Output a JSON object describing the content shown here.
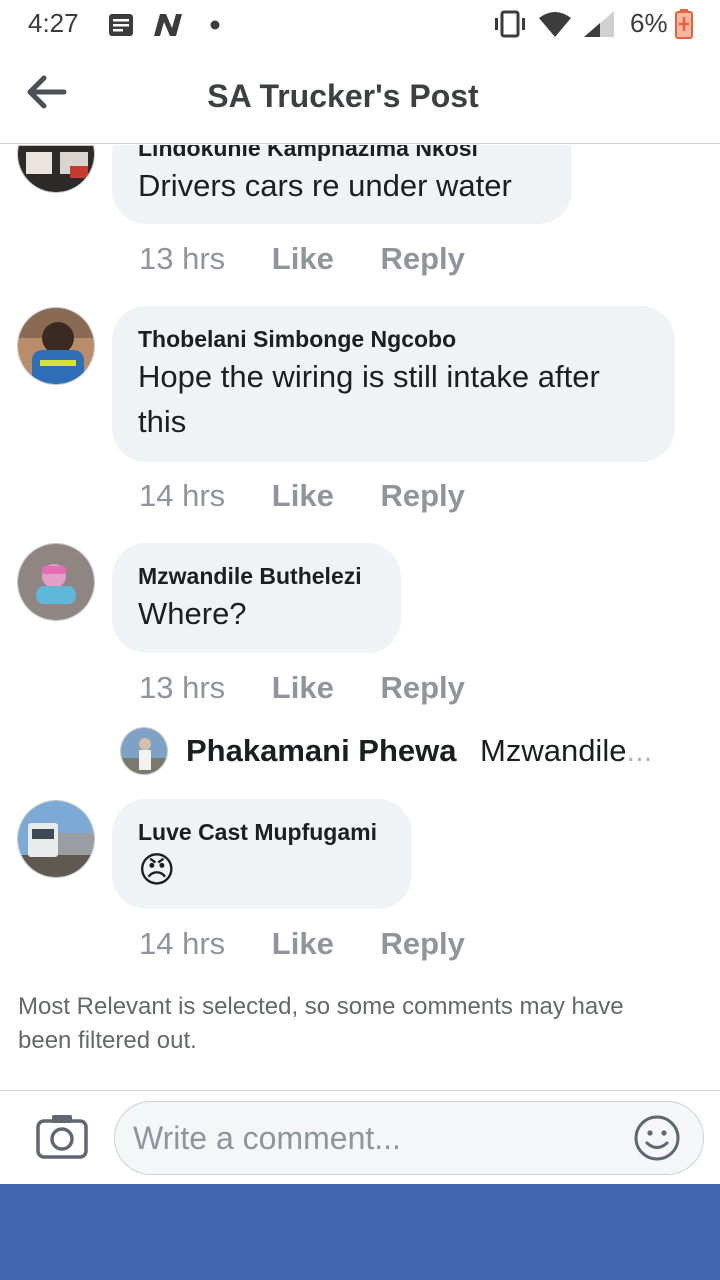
{
  "status_bar": {
    "time": "4:27",
    "battery": "6%",
    "icons": [
      "message-icon",
      "n-app-icon",
      "dot-icon",
      "vibrate-icon",
      "wifi-icon",
      "signal-icon",
      "battery-icon"
    ]
  },
  "header": {
    "title": "SA Trucker's Post",
    "back_icon": "back-arrow-icon"
  },
  "comments": [
    {
      "name": "Lindokuhle Kamphazima Nkosi",
      "text": "Drivers cars re under water",
      "time": "13 hrs",
      "like": "Like",
      "reply": "Reply"
    },
    {
      "name": "Thobelani Simbonge Ngcobo",
      "text": "Hope the wiring is still intake after this",
      "time": "14 hrs",
      "like": "Like",
      "reply": "Reply"
    },
    {
      "name": "Mzwandile Buthelezi",
      "text": "Where?",
      "time": "13 hrs",
      "like": "Like",
      "reply": "Reply"
    },
    {
      "name": "Luve Cast Mupfugami",
      "emoji": "😠",
      "time": "14 hrs",
      "like": "Like",
      "reply": "Reply"
    }
  ],
  "reply_preview": {
    "name": "Phakamani Phewa",
    "text": "Mzwandile",
    "ellipsis": "..."
  },
  "notice": "Most Relevant is selected, so some comments may have been filtered out.",
  "composer": {
    "placeholder": "Write a comment...",
    "camera_icon": "camera-icon",
    "emoji_icon": "smiley-icon"
  },
  "colors": {
    "brand_blue": "#4267b2",
    "bubble": "#f0f2f5",
    "muted": "#90949c"
  }
}
